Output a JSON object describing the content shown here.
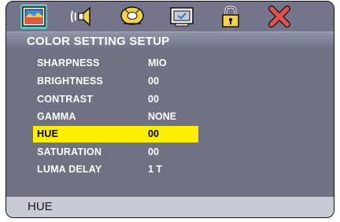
{
  "icons": [
    "picture-icon",
    "speaker-icon",
    "disc-icon",
    "monitor-check-icon",
    "lock-icon",
    "close-icon"
  ],
  "header": {
    "title": "COLOR SETTING SETUP"
  },
  "settings": [
    {
      "label": "SHARPNESS",
      "value": "MIO"
    },
    {
      "label": "BRIGHTNESS",
      "value": "00"
    },
    {
      "label": "CONTRAST",
      "value": "00"
    },
    {
      "label": "GAMMA",
      "value": "NONE"
    },
    {
      "label": "HUE",
      "value": "00"
    },
    {
      "label": "SATURATION",
      "value": "00"
    },
    {
      "label": "LUMA DELAY",
      "value": "1 T"
    }
  ],
  "selected_index": 4,
  "status": {
    "text": "HUE"
  },
  "colors": {
    "highlight": "#ffee00",
    "background": "#6e7283",
    "selected_tab": "#5fc0c0",
    "close": "#e05050"
  }
}
